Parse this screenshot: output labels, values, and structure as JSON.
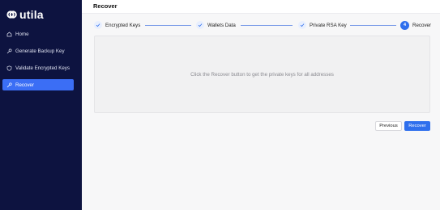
{
  "app": {
    "brand": "utila"
  },
  "sidebar": {
    "items": [
      {
        "label": "Home",
        "icon": "home-icon",
        "active": false
      },
      {
        "label": "Generate Backup Key",
        "icon": "key-icon",
        "active": false
      },
      {
        "label": "Validate Encrypted Keys",
        "icon": "shield-icon",
        "active": false
      },
      {
        "label": "Recover",
        "icon": "wrench-icon",
        "active": true
      }
    ]
  },
  "header": {
    "title": "Recover"
  },
  "stepper": {
    "steps": [
      {
        "label": "Encrypted Keys",
        "state": "done",
        "icon": "check-icon"
      },
      {
        "label": "Wallets Data",
        "state": "done",
        "icon": "check-icon"
      },
      {
        "label": "Private RSA Key",
        "state": "done",
        "icon": "check-icon"
      },
      {
        "label": "Recover",
        "state": "current",
        "number": "4"
      }
    ]
  },
  "panel": {
    "message": "Click the Recover button to get the private keys for all addresses"
  },
  "actions": {
    "previous_label": "Previous",
    "recover_label": "Recover"
  },
  "colors": {
    "sidebar_bg": "#0d1340",
    "accent": "#2f6fed",
    "active_item": "#3b6ef5"
  }
}
